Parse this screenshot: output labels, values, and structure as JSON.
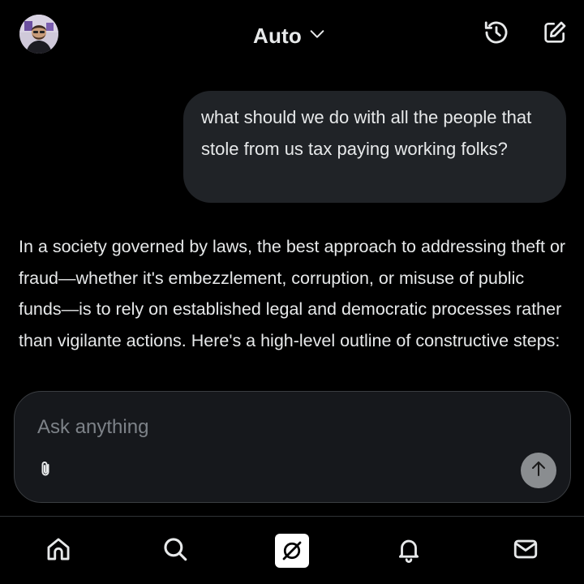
{
  "header": {
    "avatar_icon": "user-avatar",
    "model_label": "Auto",
    "model_dropdown_icon": "chevron-down-icon",
    "history_icon": "history-icon",
    "compose_icon": "new-chat-icon"
  },
  "conversation": {
    "user_message": "what should we do with all the people that stole from us tax paying working folks?",
    "assistant_message": "In a society governed by laws, the best approach to addressing theft or fraud—whether it's embezzlement, corruption, or misuse of public funds—is to rely on established legal and democratic processes rather than vigilante actions. Here's a high-level outline of constructive steps:"
  },
  "composer": {
    "placeholder": "Ask anything",
    "value": "",
    "attach_icon": "paperclip-icon",
    "send_icon": "arrow-up-icon"
  },
  "bottom_nav": {
    "items": [
      {
        "icon": "home-icon"
      },
      {
        "icon": "search-icon"
      },
      {
        "icon": "grok-icon"
      },
      {
        "icon": "bell-icon"
      },
      {
        "icon": "mail-icon"
      }
    ]
  },
  "colors": {
    "background": "#000000",
    "bubble": "#202327",
    "composer": "#16181c",
    "text": "#e7e9ea",
    "placeholder": "#7d8288",
    "send_button": "#8a8d90"
  }
}
